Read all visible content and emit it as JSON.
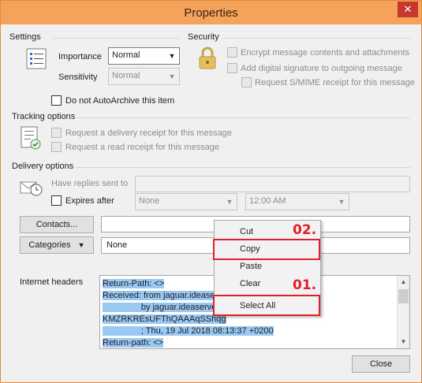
{
  "window": {
    "title": "Properties",
    "close_glyph": "✕"
  },
  "settings": {
    "heading": "Settings",
    "importance_label": "Importance",
    "importance_value": "Normal",
    "sensitivity_label": "Sensitivity",
    "sensitivity_value": "Normal",
    "do_not_autoarchive": "Do not AutoArchive this item"
  },
  "security": {
    "heading": "Security",
    "encrypt": "Encrypt message contents and attachments",
    "digital_signature": "Add digital signature to outgoing message",
    "smime_receipt": "Request S/MIME receipt for this message"
  },
  "tracking": {
    "heading": "Tracking options",
    "delivery_receipt": "Request a delivery receipt for this message",
    "read_receipt": "Request a read receipt for this message"
  },
  "delivery": {
    "heading": "Delivery options",
    "replies_label": "Have replies sent to",
    "expires_label": "Expires after",
    "expires_date": "None",
    "expires_time": "12:00 AM"
  },
  "contacts_button": "Contacts...",
  "categories_button": "Categories",
  "categories_value": "None",
  "internet_headers": {
    "label": "Internet headers",
    "lines": [
      "Return-Path: <>",
      "Received: from jaguar.ideaserv",
      "                by jaguar.ideaserve",
      "KMZRKREsUFThQAAAqSShqg",
      "                ; Thu, 19 Jul 2018 08:13:37 +0200",
      "Return-path: <>"
    ]
  },
  "context_menu": {
    "items": [
      "Cut",
      "Copy",
      "Paste",
      "Clear",
      "Select All"
    ]
  },
  "annotations": {
    "step1": "01.",
    "step2": "02."
  },
  "close_button": "Close",
  "colors": {
    "titlebar": "#f5a25a",
    "highlight": "#e0202c",
    "selection": "#99c8f2"
  }
}
